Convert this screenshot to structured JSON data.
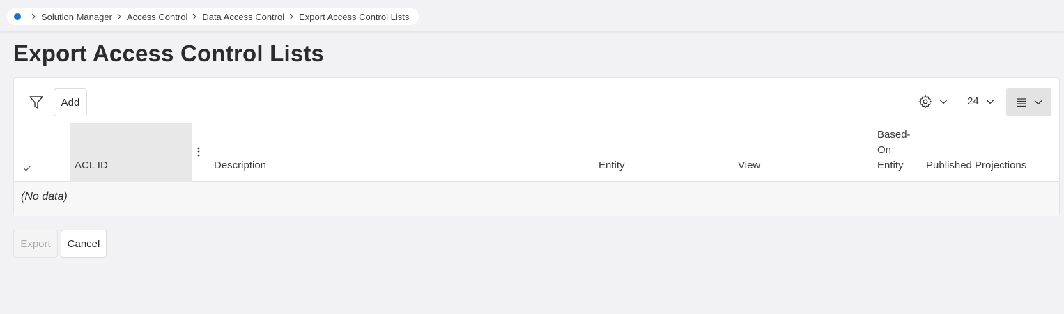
{
  "breadcrumb": {
    "items": [
      "Solution Manager",
      "Access Control",
      "Data Access Control",
      "Export Access Control Lists"
    ]
  },
  "page": {
    "title": "Export Access Control Lists"
  },
  "toolbar": {
    "add_label": "Add",
    "page_size": "24",
    "icons": [
      "filter-icon",
      "gear-icon",
      "list-view-icon",
      "chevron-down-icon"
    ]
  },
  "table": {
    "columns": [
      "ACL ID",
      "Description",
      "Entity",
      "View",
      "Based-On Entity",
      "Published Projections"
    ],
    "based_on_lines": [
      "Based-",
      "On",
      "Entity"
    ],
    "empty_text": "(No data)"
  },
  "footer": {
    "export_label": "Export",
    "cancel_label": "Cancel"
  },
  "colors": {
    "accent": "#1a73c8",
    "background": "#f2f1f3",
    "disabled_text": "#a9a9a9"
  }
}
